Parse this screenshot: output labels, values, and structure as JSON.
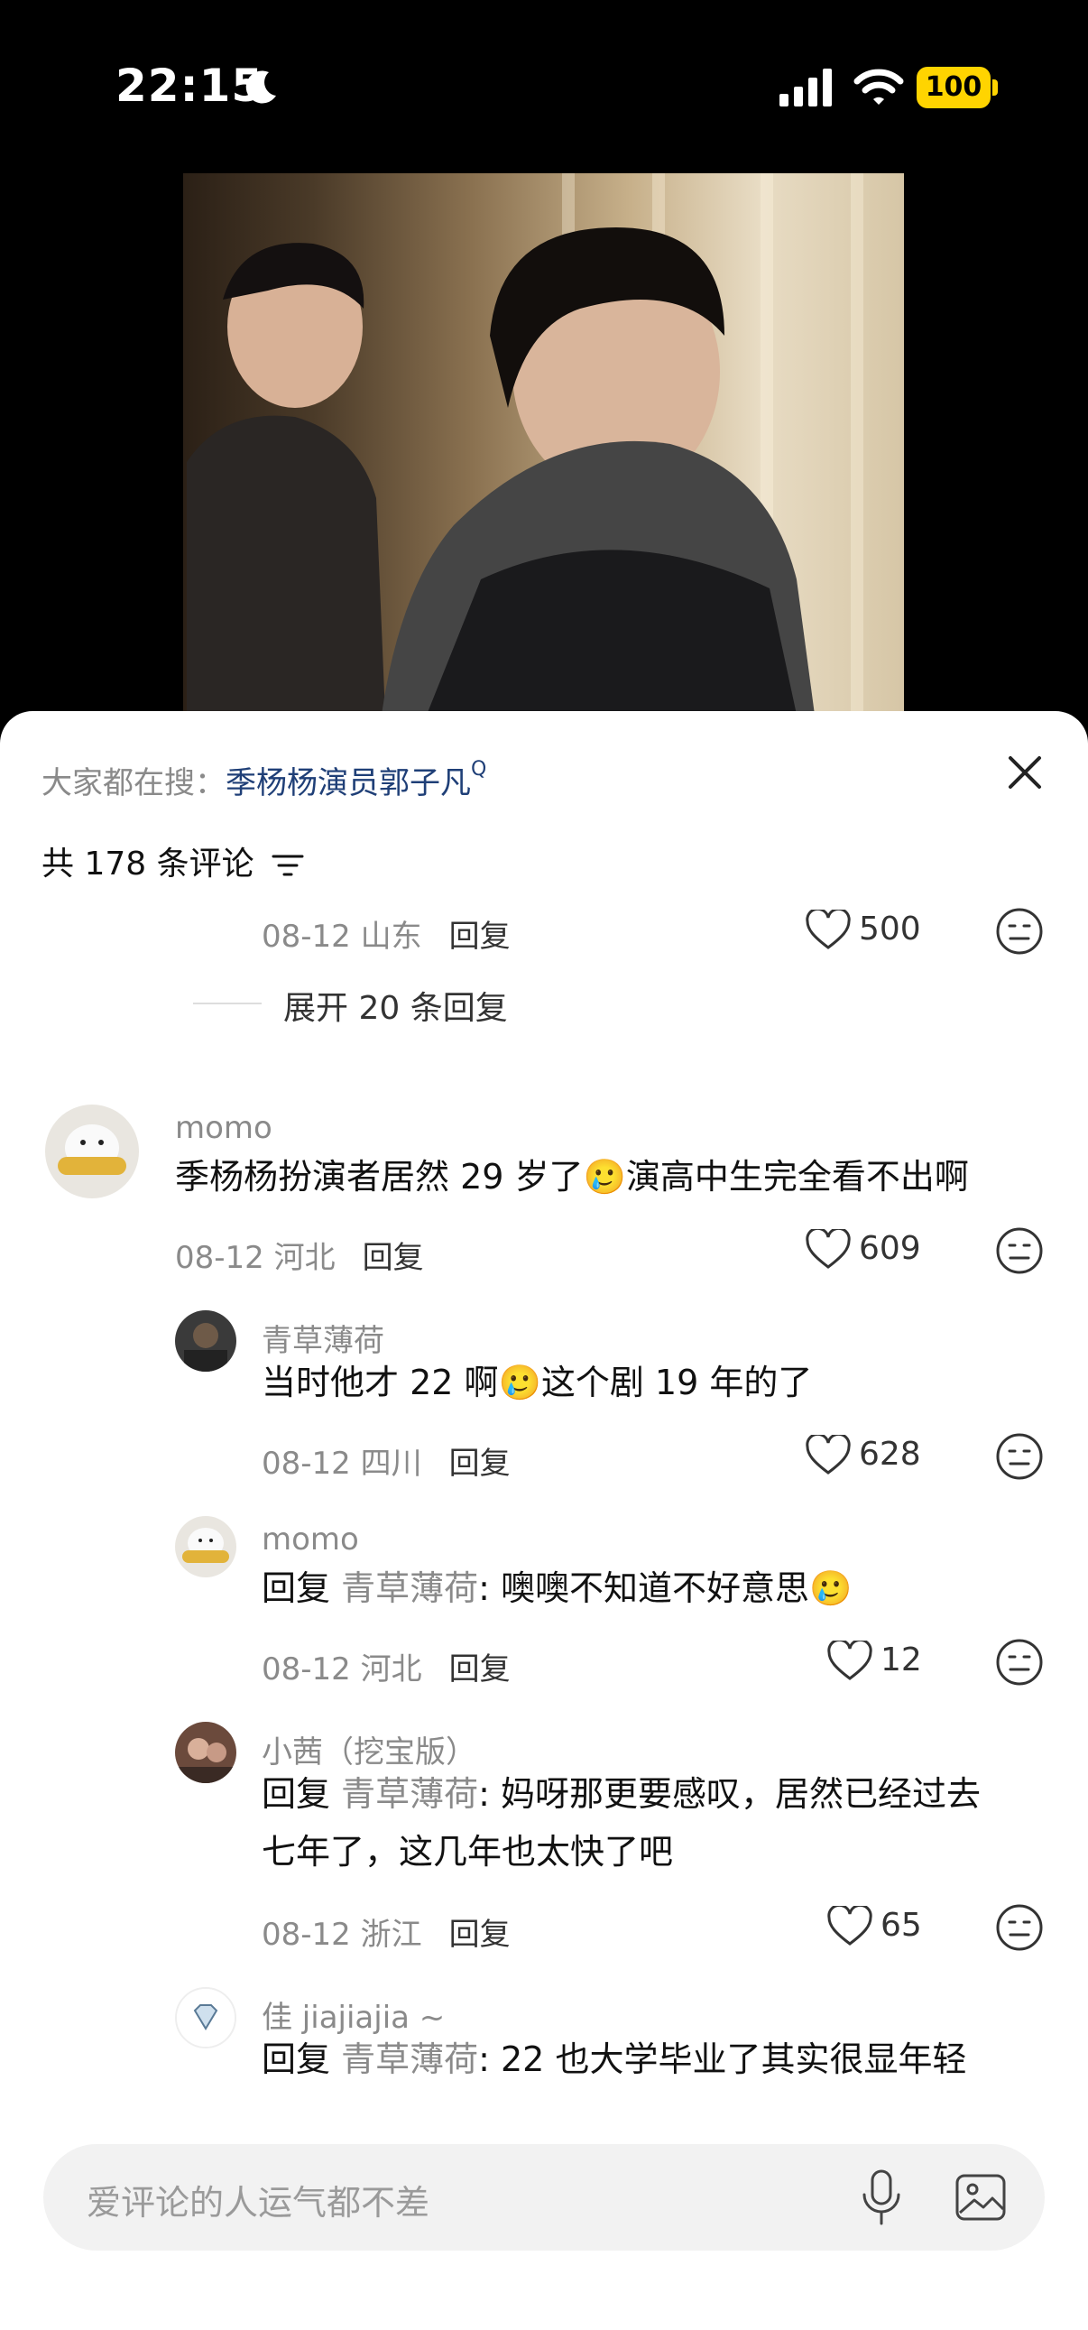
{
  "status": {
    "time": "22:15",
    "battery": "100"
  },
  "search": {
    "prefix": "大家都在搜：",
    "term": "季杨杨演员郭子凡",
    "mark": "Q"
  },
  "count_label": "共 178 条评论",
  "prev_meta": {
    "date": "08-12 山东",
    "reply": "回复",
    "likes": "500"
  },
  "expand_label": "展开 20 条回复",
  "comments": [
    {
      "user": "momo",
      "text": "季杨杨扮演者居然 29 岁了🥲演高中生完全看不出啊",
      "date": "08-12 河北",
      "reply": "回复",
      "likes": "609"
    },
    {
      "user": "青草薄荷",
      "text": "当时他才 22 啊🥲这个剧 19 年的了",
      "date": "08-12 四川",
      "reply": "回复",
      "likes": "628"
    },
    {
      "user": "momo",
      "reply_prefix": "回复",
      "at": "青草薄荷",
      "text": ": 噢噢不知道不好意思🥲",
      "date": "08-12 河北",
      "reply": "回复",
      "likes": "12"
    },
    {
      "user": "小茜（挖宝版）",
      "reply_prefix": "回复",
      "at": "青草薄荷",
      "text": ": 妈呀那更要感叹，居然已经过去",
      "text2": "七年了，这几年也太快了吧",
      "date": "08-12 浙江",
      "reply": "回复",
      "likes": "65"
    },
    {
      "user": "佳 jiajiajia ~",
      "reply_prefix": "回复",
      "at": "青草薄荷",
      "text": ": 22 也大学毕业了其实很显年轻"
    }
  ],
  "input": {
    "placeholder": "爱评论的人运气都不差"
  }
}
